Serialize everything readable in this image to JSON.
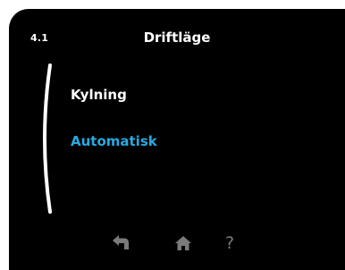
{
  "header": {
    "menu_number": "4.1",
    "title": "Driftläge"
  },
  "options": [
    {
      "label": "Kylning",
      "selected": false
    },
    {
      "label": "Automatisk",
      "selected": true
    }
  ],
  "colors": {
    "background": "#000000",
    "text": "#ffffff",
    "selected": "#2aa9e0",
    "nav_icon": "#7a7a7a"
  },
  "nav": {
    "back_icon": "back-arrow-icon",
    "home_icon": "home-icon",
    "help_icon": "help-icon",
    "help_glyph": "?"
  }
}
